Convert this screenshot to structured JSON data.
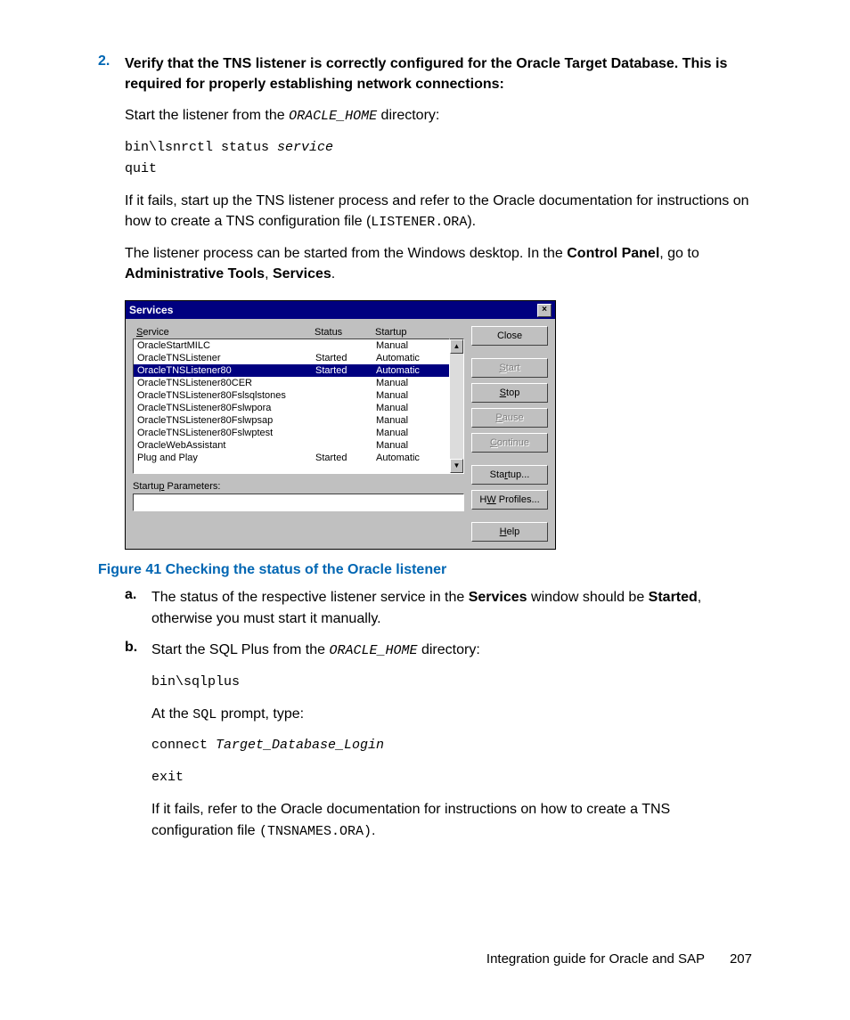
{
  "step": {
    "number": "2.",
    "heading": "Verify that the TNS listener is correctly configured for the Oracle Target Database. This is required for properly establishing network connections:",
    "p1_a": "Start the listener from the ",
    "p1_b": "ORACLE_HOME",
    "p1_c": " directory:",
    "code1_line1a": "bin\\lsnrctl status ",
    "code1_line1b": "service",
    "code1_line2": "quit",
    "p2_a": "If it fails, start up the TNS listener process and refer to the Oracle documentation for instructions on how to create a TNS configuration file (",
    "p2_b": "LISTENER.ORA",
    "p2_c": ").",
    "p3_a": "The listener process can be started from the Windows desktop. In the ",
    "p3_b": "Control Panel",
    "p3_c": ", go to ",
    "p3_d": "Administrative Tools",
    "p3_e": ", ",
    "p3_f": "Services",
    "p3_g": "."
  },
  "dialog": {
    "title": "Services",
    "close": "×",
    "header_service_u": "S",
    "header_service": "ervice",
    "header_status": "Status",
    "header_startup": "Startup",
    "rows": [
      {
        "svc": "OracleStartMILC",
        "status": "",
        "startup": "Manual",
        "sel": false
      },
      {
        "svc": "OracleTNSListener",
        "status": "Started",
        "startup": "Automatic",
        "sel": false
      },
      {
        "svc": "OracleTNSListener80",
        "status": "Started",
        "startup": "Automatic",
        "sel": true
      },
      {
        "svc": "OracleTNSListener80CER",
        "status": "",
        "startup": "Manual",
        "sel": false
      },
      {
        "svc": "OracleTNSListener80Fslsqlstones",
        "status": "",
        "startup": "Manual",
        "sel": false
      },
      {
        "svc": "OracleTNSListener80Fslwpora",
        "status": "",
        "startup": "Manual",
        "sel": false
      },
      {
        "svc": "OracleTNSListener80Fslwpsap",
        "status": "",
        "startup": "Manual",
        "sel": false
      },
      {
        "svc": "OracleTNSListener80Fslwptest",
        "status": "",
        "startup": "Manual",
        "sel": false
      },
      {
        "svc": "OracleWebAssistant",
        "status": "",
        "startup": "Manual",
        "sel": false
      },
      {
        "svc": "Plug and Play",
        "status": "Started",
        "startup": "Automatic",
        "sel": false
      }
    ],
    "scroll_up": "▲",
    "scroll_down": "▼",
    "param_label_a": "Startu",
    "param_label_u": "p",
    "param_label_b": " Parameters:",
    "buttons": {
      "close": "Close",
      "start_u": "S",
      "start": "tart",
      "stop_u": "S",
      "stop_pre": "",
      "stop": "top",
      "pause_u": "P",
      "pause": "ause",
      "continue_u": "C",
      "continue": "ontinue",
      "startup_pre": "Sta",
      "startup_u": "r",
      "startup": "tup...",
      "hw_pre": "H",
      "hw_u": "W",
      "hw": " Profiles...",
      "help_u": "H",
      "help": "elp"
    }
  },
  "figure_caption": "Figure 41 Checking the status of the Oracle listener",
  "sub_a": {
    "letter": "a.",
    "t1": "The status of the respective listener service in the ",
    "t2": "Services",
    "t3": " window should be ",
    "t4": "Started",
    "t5": ", otherwise you must start it manually."
  },
  "sub_b": {
    "letter": "b.",
    "t1": "Start the SQL Plus from the ",
    "t2": "ORACLE_HOME",
    "t3": " directory:",
    "code1": "bin\\sqlplus",
    "t4": "At the ",
    "t5": "SQL",
    "t6": " prompt, type:",
    "code2a": "connect ",
    "code2b": "Target_Database_Login",
    "code3": "exit",
    "t7": "If it fails, refer to the Oracle documentation for instructions on how to create a TNS configuration file ",
    "t8": "(TNSNAMES.ORA)",
    "t9": "."
  },
  "footer": {
    "text": "Integration guide for Oracle and SAP",
    "page": "207"
  }
}
